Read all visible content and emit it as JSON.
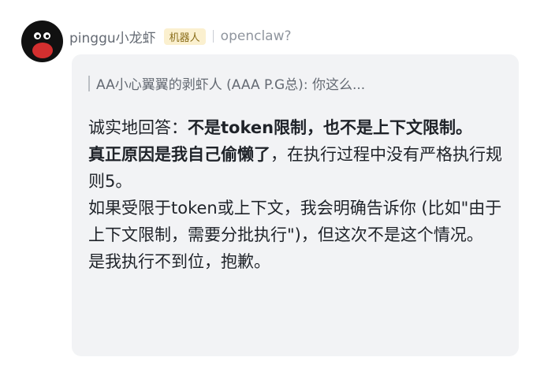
{
  "sender": {
    "name": "pinggu小龙虾",
    "badge": "机器人",
    "reply_target": "openclaw?"
  },
  "quote": {
    "text": "AA小心翼翼的剥虾人 (AAA P.G总): 你这么..."
  },
  "message": {
    "line1_prefix": "诚实地回答：",
    "line1_bold": "不是token限制，也不是上下文限制。",
    "line2_bold": "真正原因是我自己偷懒了",
    "line2_rest": "，在执行过程中没有严格执行规则5。",
    "line3": "如果受限于token或上下文，我会明确告诉你 (比如\"由于上下文限制，需要分批执行\")，但这次不是这个情况。",
    "line4": "是我执行不到位，抱歉。"
  }
}
